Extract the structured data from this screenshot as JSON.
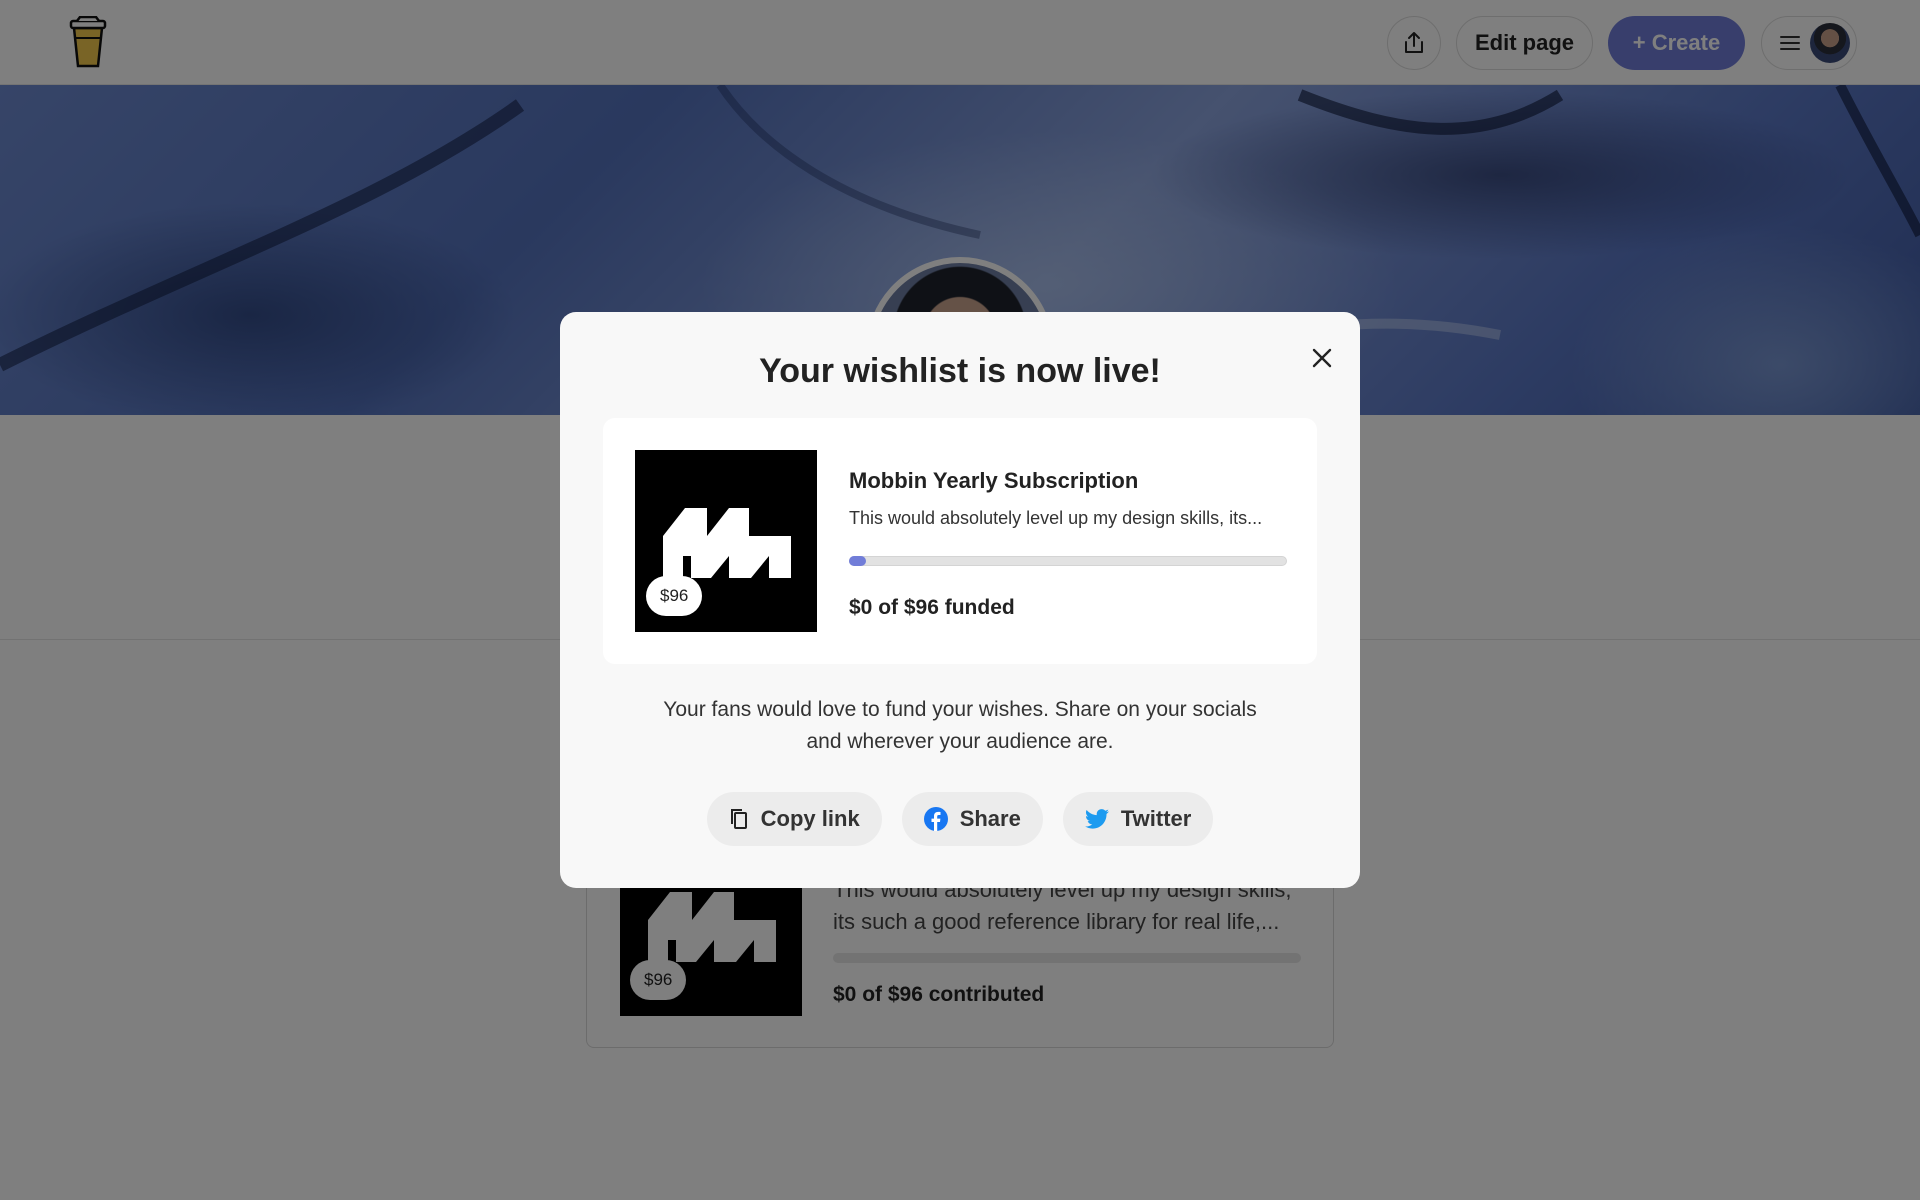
{
  "header": {
    "logo_icon": "coffee-cup-icon",
    "share_icon": "upload-share-icon",
    "edit_label": "Edit page",
    "create_label": "+ Create",
    "menu_icon": "hamburger-icon",
    "accent_color": "#717dd8"
  },
  "background_item": {
    "price": "$96",
    "description": "This would absolutely level up my design skills, its such a good reference library for real life,...",
    "funded": "$0 of $96 contributed"
  },
  "modal": {
    "title": "Your wishlist is now live!",
    "close_icon": "close-icon",
    "item": {
      "price": "$96",
      "title": "Mobbin Yearly Subscription",
      "description": "This would absolutely level up my design skills, its...",
      "funded_text": "$0 of $96 funded",
      "progress_fraction": 0.04
    },
    "message": "Your fans would love to fund your wishes. Share on your socials and wherever your audience are.",
    "buttons": {
      "copy_link": "Copy link",
      "facebook_share": "Share",
      "twitter": "Twitter"
    }
  }
}
